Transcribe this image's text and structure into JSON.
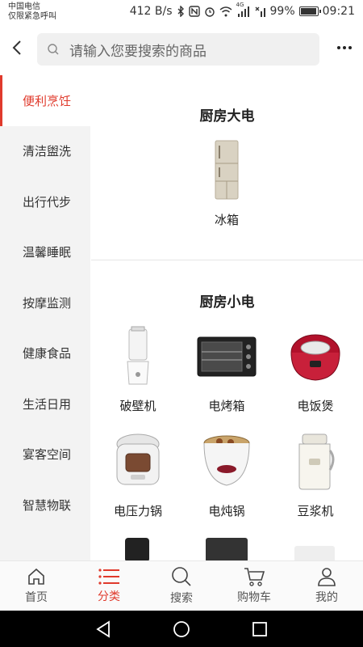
{
  "status_bar": {
    "carrier_line1": "中国电信",
    "carrier_line2": "仅限紧急呼叫",
    "network_speed": "412 B/s",
    "battery": "99%",
    "battery_level": 0.99,
    "time": "09:21",
    "network_badge": "4G"
  },
  "header": {
    "search_placeholder": "请输入您要搜索的商品"
  },
  "sidebar": {
    "items": [
      {
        "label": "便利烹饪",
        "active": true
      },
      {
        "label": "清洁盥洗",
        "active": false
      },
      {
        "label": "出行代步",
        "active": false
      },
      {
        "label": "温馨睡眠",
        "active": false
      },
      {
        "label": "按摩监测",
        "active": false
      },
      {
        "label": "健康食品",
        "active": false
      },
      {
        "label": "生活日用",
        "active": false
      },
      {
        "label": "宴客空间",
        "active": false
      },
      {
        "label": "智慧物联",
        "active": false
      }
    ]
  },
  "main": {
    "sections": [
      {
        "title": "厨房大电",
        "items": [
          {
            "label": "冰箱",
            "icon": "refrigerator"
          }
        ]
      },
      {
        "title": "厨房小电",
        "items": [
          {
            "label": "破壁机",
            "icon": "blender"
          },
          {
            "label": "电烤箱",
            "icon": "oven"
          },
          {
            "label": "电饭煲",
            "icon": "rice-cooker"
          },
          {
            "label": "电压力锅",
            "icon": "pressure-cooker"
          },
          {
            "label": "电炖锅",
            "icon": "stew-pot"
          },
          {
            "label": "豆浆机",
            "icon": "soymilk-maker"
          }
        ]
      }
    ]
  },
  "tabbar": {
    "tabs": [
      {
        "label": "首页",
        "icon": "home",
        "active": false
      },
      {
        "label": "分类",
        "icon": "list",
        "active": true
      },
      {
        "label": "搜索",
        "icon": "search",
        "active": false
      },
      {
        "label": "购物车",
        "icon": "cart",
        "active": false
      },
      {
        "label": "我的",
        "icon": "user",
        "active": false
      }
    ]
  },
  "colors": {
    "accent": "#e03a2c",
    "sidebar_bg": "#f3f3f3"
  }
}
